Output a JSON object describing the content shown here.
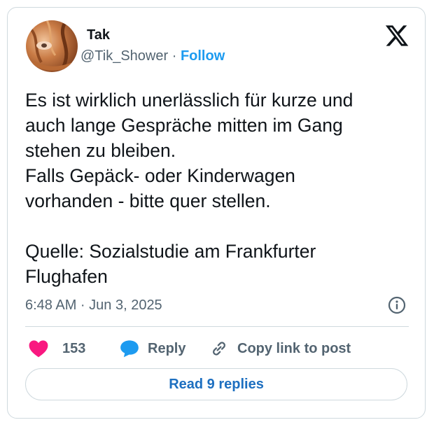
{
  "author": {
    "name": "Tak",
    "handle": "@Tik_Shower",
    "separator": " · ",
    "follow_label": "Follow"
  },
  "icons": {
    "avatar": "avatar-photo",
    "platform": "x-logo",
    "like": "heart-icon",
    "reply": "speech-bubble-icon",
    "copy_link": "link-icon",
    "info": "info-icon"
  },
  "tweet": {
    "text": "Es ist wirklich unerlässlich für kurze und\nauch lange Gespräche mitten im Gang\nstehen zu bleiben.\nFalls Gepäck- oder Kinderwagen\nvorhanden - bitte quer stellen.\n\nQuelle: Sozialstudie am Frankfurter\nFlughafen",
    "timestamp": "6:48 AM · Jun 3, 2025"
  },
  "actions": {
    "like_count": "153",
    "reply_label": "Reply",
    "copy_link_label": "Copy link to post"
  },
  "footer": {
    "read_replies_label": "Read 9 replies"
  },
  "colors": {
    "like": "#f91880",
    "reply": "#1d9bf0",
    "link_text": "#1d9bf0",
    "muted": "#536471",
    "border": "#cfd9de"
  }
}
